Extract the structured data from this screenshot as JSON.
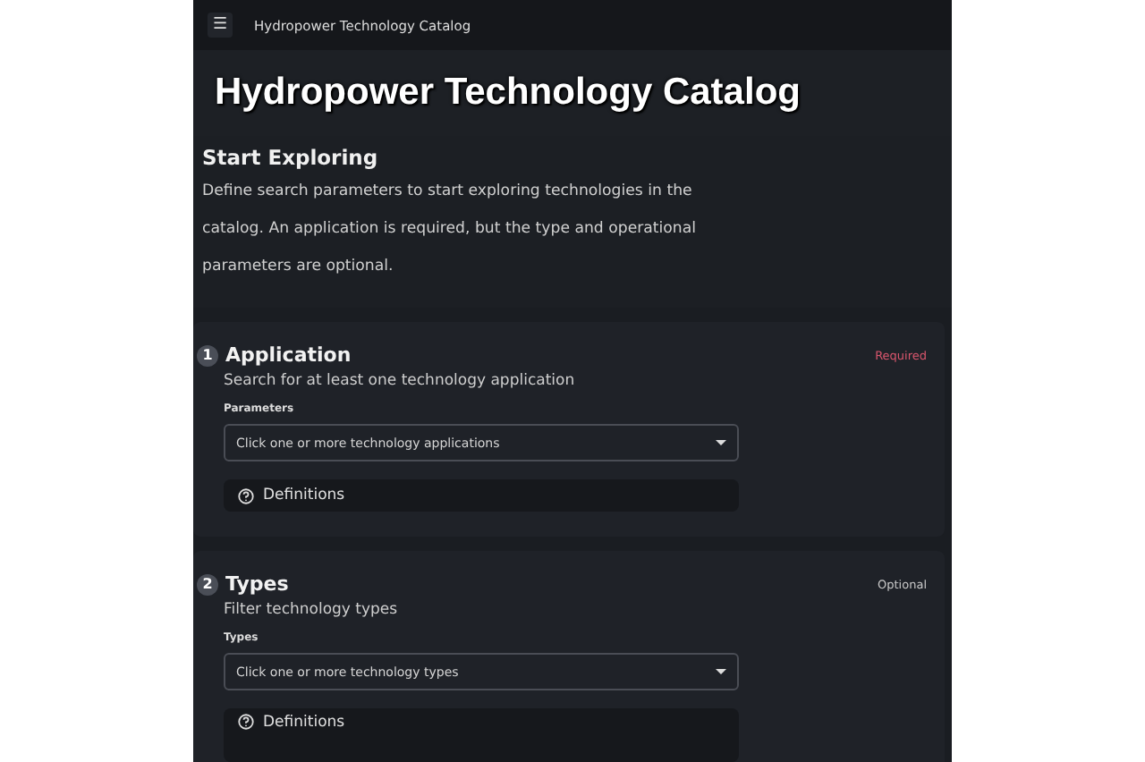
{
  "top_bar": {
    "menu_icon": "☰",
    "title": "Hydropower Technology Catalog"
  },
  "page_title": "Hydropower Technology Catalog",
  "intro": {
    "heading": "Start Exploring",
    "text": "Define search parameters to start exploring technologies in the catalog. An application is required, but the type and operational parameters are optional."
  },
  "sections": [
    {
      "number": "1",
      "title": "Application",
      "status": {
        "label": "Required",
        "kind": "required"
      },
      "subtitle": "Search for at least one technology application",
      "field_label": "Parameters",
      "placeholder": "Click one or more technology applications",
      "definitions": "Definitions"
    },
    {
      "number": "2",
      "title": "Types",
      "status": {
        "label": "Optional",
        "kind": "optional"
      },
      "subtitle": "Filter technology types",
      "field_label": "Types",
      "placeholder": "Click one or more technology types",
      "definitions": "Definitions"
    }
  ]
}
